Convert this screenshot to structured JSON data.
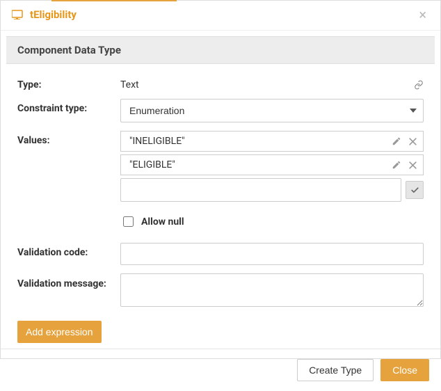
{
  "header": {
    "title": "tEligibility"
  },
  "section": {
    "title": "Component Data Type"
  },
  "labels": {
    "type": "Type:",
    "constraint_type": "Constraint type:",
    "values": "Values:",
    "allow_null": "Allow null",
    "validation_code": "Validation code:",
    "validation_message": "Validation message:"
  },
  "type_value": "Text",
  "constraint": {
    "selected": "Enumeration"
  },
  "enum_values": [
    "\"INELIGIBLE\"",
    "\"ELIGIBLE\""
  ],
  "new_value_placeholder": "",
  "allow_null_checked": false,
  "validation_code": "",
  "validation_message": "",
  "buttons": {
    "add_expression": "Add expression",
    "create_type": "Create Type",
    "close": "Close"
  }
}
